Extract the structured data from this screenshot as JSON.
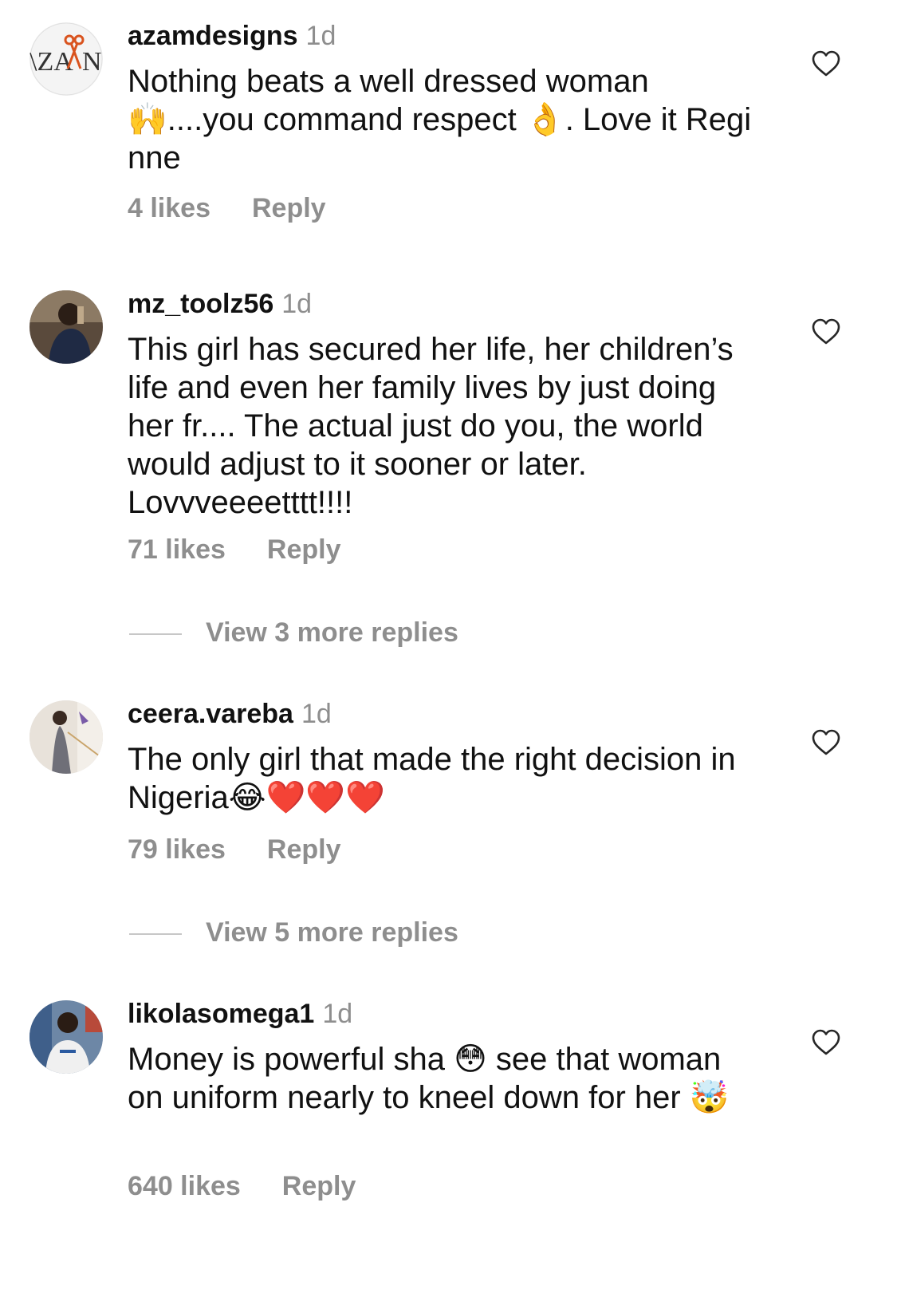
{
  "comments": [
    {
      "username": "azamdesigns",
      "time": "1d",
      "text": "Nothing beats a well dressed woman 🙌....you command respect 👌. Love it Regi nne",
      "likes": "4 likes",
      "reply": "Reply",
      "avatar_icon": "azam-logo-avatar"
    },
    {
      "username": "mz_toolz56",
      "time": "1d",
      "text": "This girl has secured her life, her children’s life and even her family lives by just doing her fr.... The actual just do you, the world would adjust to it sooner or later. Lovvveeeetttt!!!!",
      "likes": "71 likes",
      "reply": "Reply",
      "view_more": "View 3 more replies",
      "avatar_icon": "profile-photo-avatar"
    },
    {
      "username": "ceera.vareba",
      "time": "1d",
      "text": "The only girl that made the right decision in Nigeria😂❤️❤️❤️",
      "likes": "79 likes",
      "reply": "Reply",
      "view_more": "View 5 more replies",
      "avatar_icon": "profile-photo-avatar"
    },
    {
      "username": "likolasomega1",
      "time": "1d",
      "text": "Money is powerful sha 😳 see that woman on uniform nearly to kneel down for her 🤯",
      "likes": "640 likes",
      "reply": "Reply",
      "avatar_icon": "profile-photo-avatar"
    }
  ],
  "colors": {
    "text": "#111111",
    "secondary": "#8e8e8e",
    "divider": "#c7c7c7"
  }
}
